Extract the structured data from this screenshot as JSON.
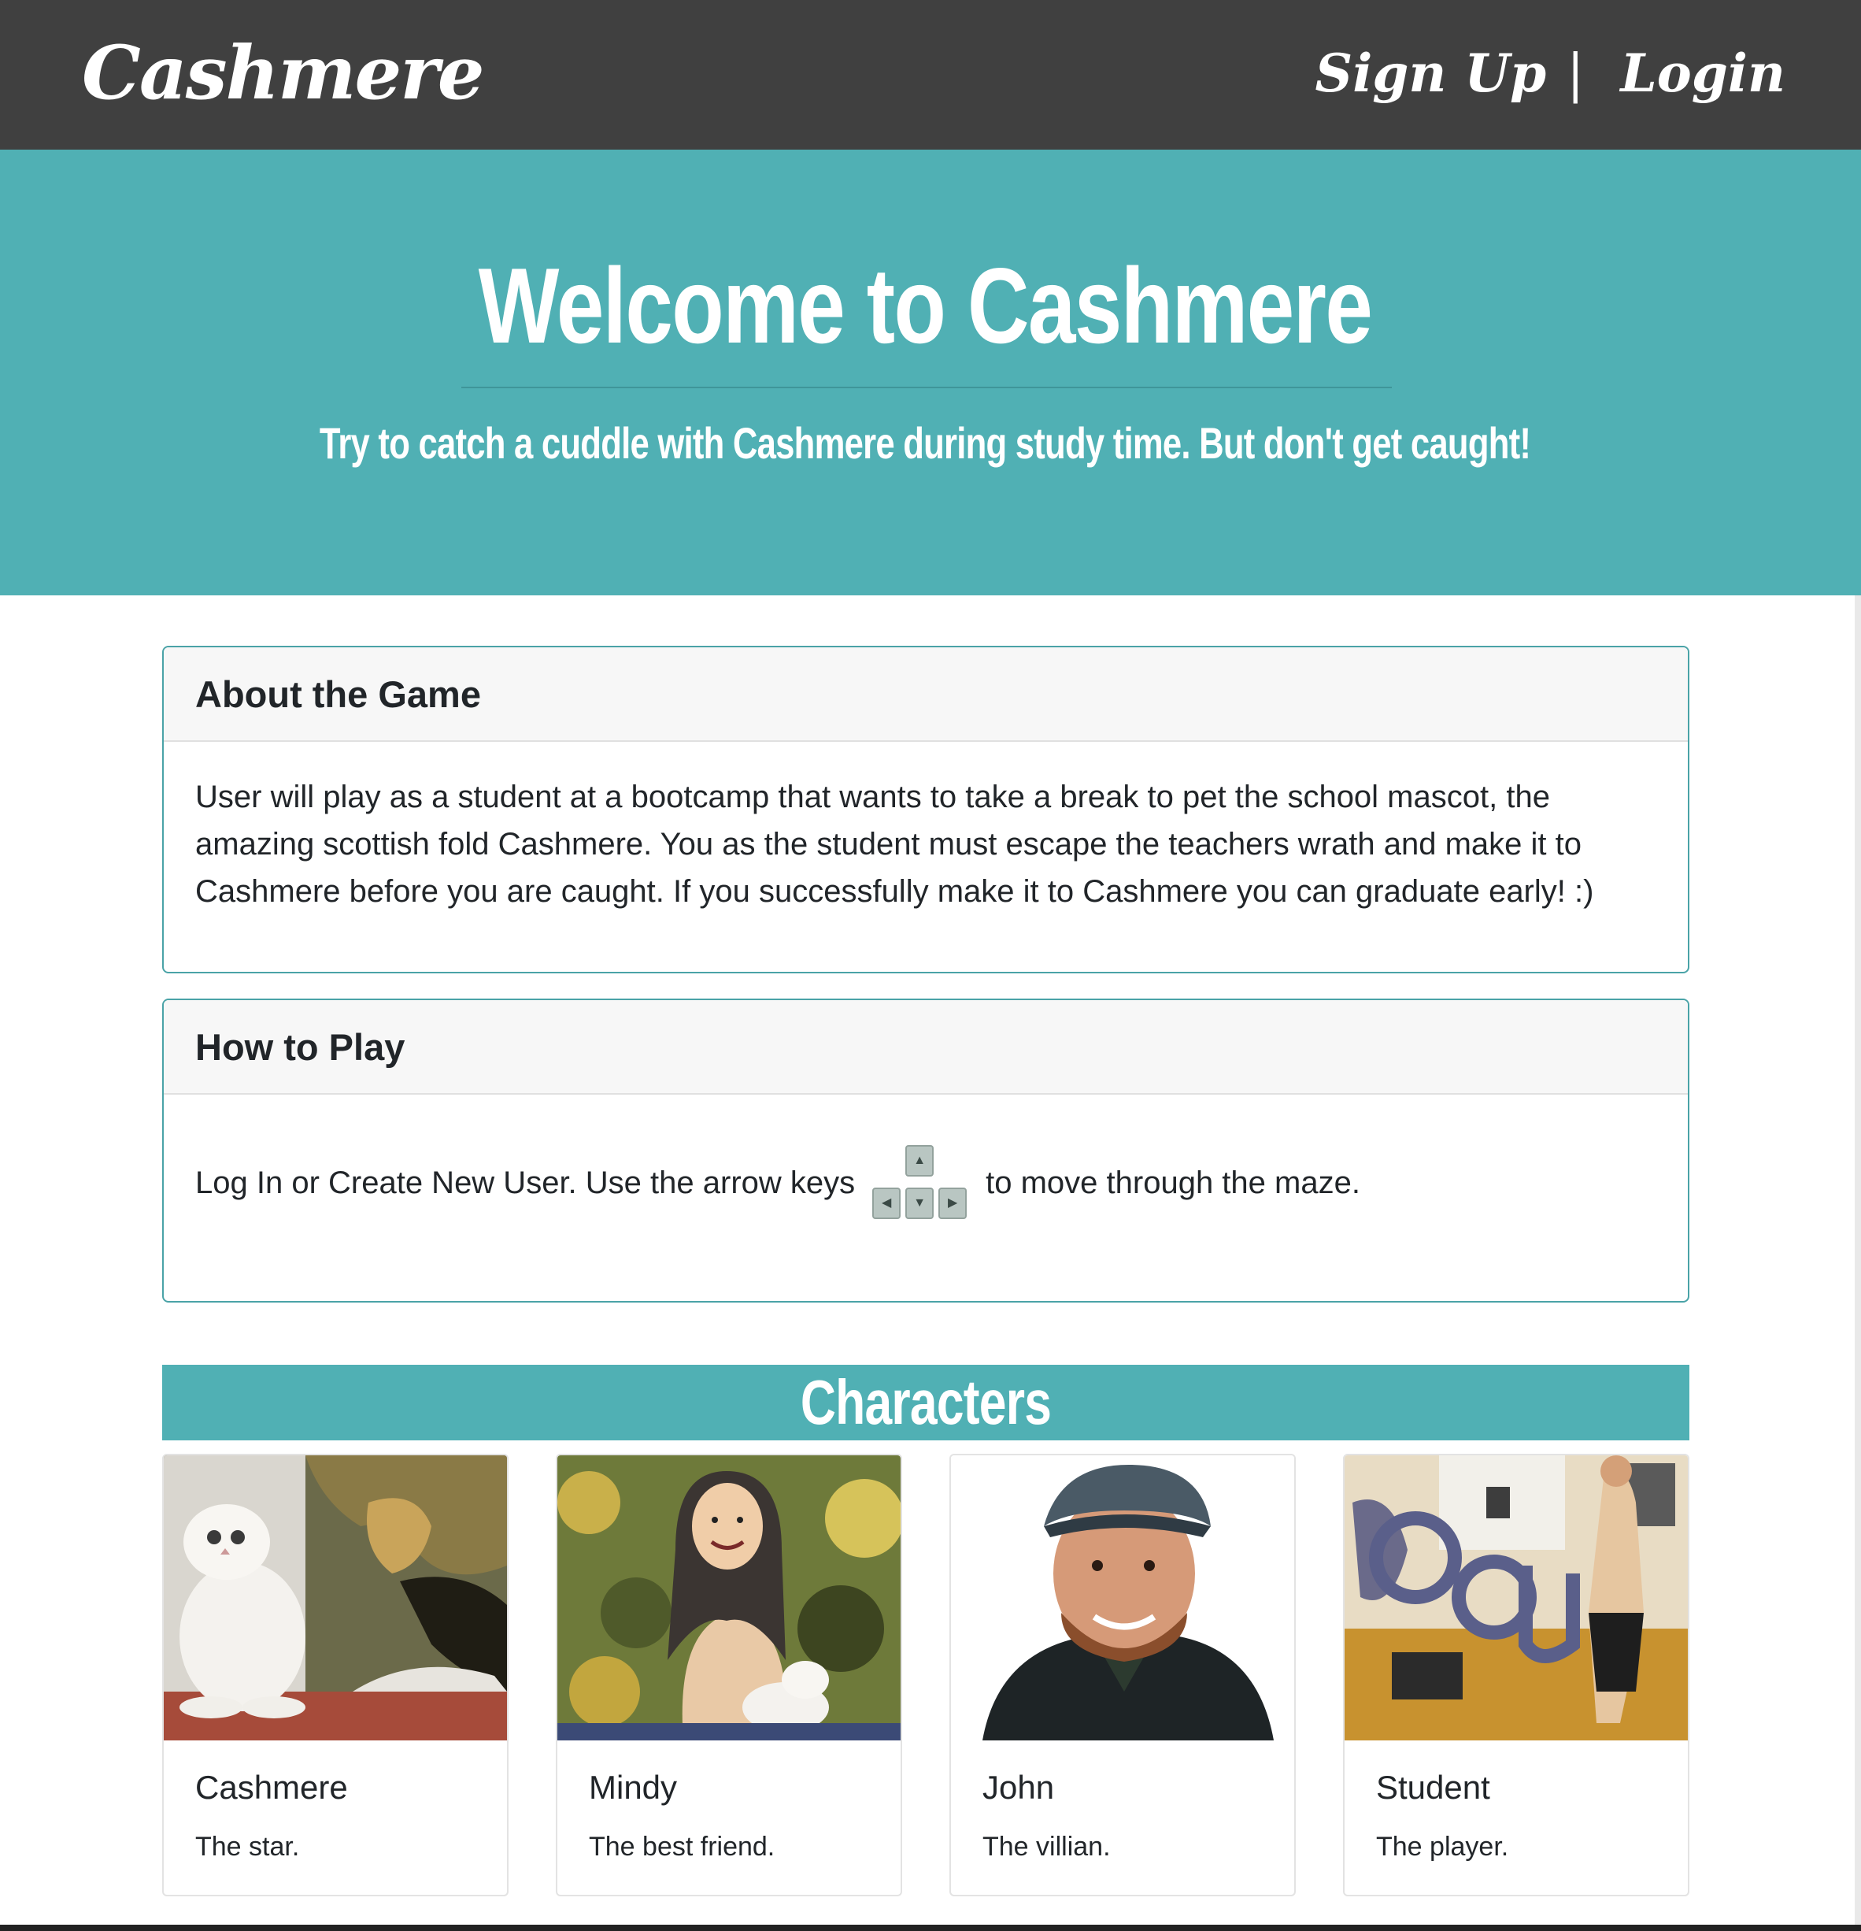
{
  "nav": {
    "brand": "Cashmere",
    "signup_label": "Sign Up",
    "separator": "|",
    "login_label": "Login"
  },
  "hero": {
    "title": "Welcome to Cashmere",
    "subtitle": "Try to catch a cuddle with Cashmere during study time. But don't get caught!"
  },
  "about": {
    "title": "About the Game",
    "text": "User will play as a student at a bootcamp that wants to take a break to pet the school mascot, the amazing scottish fold Cashmere. You as the student must escape the teachers wrath and make it to Cashmere before you are caught. If you successfully make it to Cashmere you can graduate early! :)"
  },
  "howto": {
    "title": "How to Play",
    "text_before": "Log In or Create New User. Use the arrow keys",
    "text_after": "to move through the maze.",
    "keys": {
      "up": "▲",
      "left": "◀",
      "down": "▼",
      "right": "▶"
    }
  },
  "characters": {
    "title": "Characters",
    "items": [
      {
        "name": "Cashmere",
        "description": "The star.",
        "image": "white-cat-illustration"
      },
      {
        "name": "Mindy",
        "description": "The best friend.",
        "image": "woman-holding-cat-illustration"
      },
      {
        "name": "John",
        "description": "The villian.",
        "image": "smiling-man-cap-illustration"
      },
      {
        "name": "Student",
        "description": "The player.",
        "image": "bootcamp-classroom-illustration"
      }
    ]
  },
  "colors": {
    "navbar": "#404040",
    "accent": "#50b0b4",
    "card_border": "#4aa3a7",
    "card_header_bg": "#f7f7f7"
  }
}
